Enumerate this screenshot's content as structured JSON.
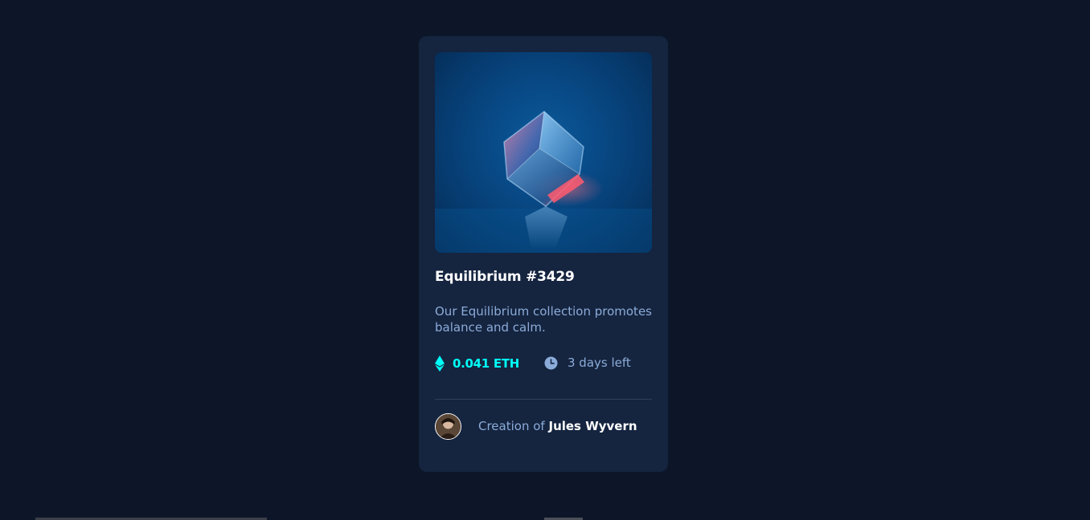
{
  "card": {
    "title": "Equilibrium #3429",
    "description": "Our Equilibrium collection promotes balance and calm.",
    "price": "0.041 ETH",
    "time_left": "3 days left",
    "creator_prefix": "Creation of",
    "creator_name": "Jules Wyvern"
  },
  "icons": {
    "price": "ethereum-icon",
    "time": "clock-icon",
    "creator": "avatar"
  },
  "colors": {
    "background": "#0d1628",
    "card": "#15243f",
    "accent_cyan": "#00fff8",
    "soft_blue": "#8bacd9",
    "white": "#ffffff",
    "divider": "#2e405e"
  }
}
